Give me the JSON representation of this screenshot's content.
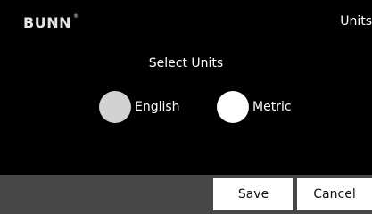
{
  "header": {
    "logo_text": "BUNN",
    "logo_mark": "®",
    "title": "Units"
  },
  "main": {
    "prompt": "Select Units",
    "options": [
      {
        "label": "English",
        "selected": true
      },
      {
        "label": "Metric",
        "selected": false
      }
    ]
  },
  "footer": {
    "save_label": "Save",
    "cancel_label": "Cancel"
  },
  "colors": {
    "background": "#000000",
    "bottom_bar": "#474747",
    "radio_selected": "#d2d2d2",
    "radio_unselected": "#ffffff",
    "button_bg": "#ffffff",
    "button_text": "#111111"
  }
}
